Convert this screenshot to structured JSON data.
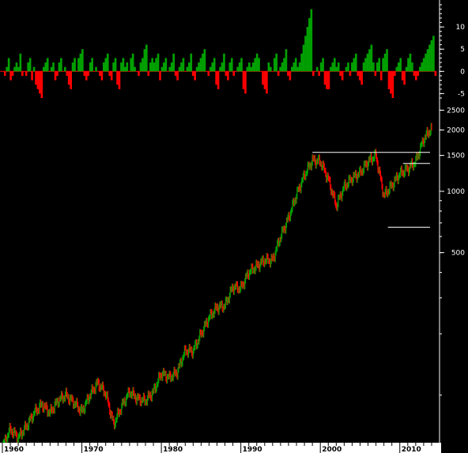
{
  "chart_data": [
    {
      "type": "bar",
      "panel": "momentum",
      "y_scale": "linear",
      "ylim": [
        -6,
        15
      ],
      "y_ticks": [
        10,
        5,
        0,
        -5
      ],
      "positive_color": "#00a000",
      "negative_color": "#ff0000",
      "x_range": [
        1959.7,
        2014.6
      ],
      "x": [
        1960.0,
        1960.5,
        1961.0,
        1961.5,
        1962.0,
        1962.5,
        1963.0,
        1963.5,
        1964.0,
        1964.5,
        1965.0,
        1965.5,
        1966.0,
        1966.5,
        1967.0,
        1967.5,
        1968.0,
        1968.5,
        1969.0,
        1969.5,
        1970.0,
        1970.5,
        1971.0,
        1971.5,
        1972.0,
        1972.5,
        1973.0,
        1973.5,
        1974.0,
        1974.5,
        1975.0,
        1975.5,
        1976.0,
        1976.5,
        1977.0,
        1977.5,
        1978.0,
        1978.5,
        1979.0,
        1979.5,
        1980.0,
        1980.5,
        1981.0,
        1981.5,
        1982.0,
        1982.5,
        1983.0,
        1983.5,
        1984.0,
        1984.5,
        1985.0,
        1985.5,
        1986.0,
        1986.5,
        1987.0,
        1987.5,
        1988.0,
        1988.5,
        1989.0,
        1989.5,
        1990.0,
        1990.5,
        1991.0,
        1991.5,
        1992.0,
        1992.5,
        1993.0,
        1993.5,
        1994.0,
        1994.5,
        1995.0,
        1995.5,
        1996.0,
        1996.5,
        1997.0,
        1997.5,
        1998.0,
        1998.5,
        1999.0,
        1999.5,
        2000.0,
        2000.5,
        2001.0,
        2001.5,
        2002.0,
        2002.5,
        2003.0,
        2003.5,
        2004.0,
        2004.5,
        2005.0,
        2005.5,
        2006.0,
        2006.5,
        2007.0,
        2007.5,
        2008.0,
        2008.5,
        2009.0,
        2009.5,
        2010.0,
        2010.5,
        2011.0,
        2011.5,
        2012.0,
        2012.5,
        2013.0,
        2013.5,
        2014.0,
        2014.5
      ],
      "values": [
        0,
        0,
        -1,
        1,
        3,
        -2,
        -1,
        1,
        2,
        1,
        4,
        -1,
        0,
        -1,
        2,
        3,
        -2,
        1,
        -3,
        -4,
        -5,
        -6,
        1,
        2,
        3,
        0,
        1,
        2,
        -2,
        -1,
        2,
        3,
        0,
        1,
        -1,
        -3,
        -4,
        2,
        3,
        0,
        3,
        4,
        5,
        -1,
        -2,
        -1,
        2,
        3,
        0,
        1,
        0,
        -1,
        -2,
        2,
        3,
        4,
        -1,
        -2,
        2,
        3,
        -3,
        -4,
        2,
        3,
        1,
        2,
        0,
        3,
        4,
        1,
        0,
        -1,
        2,
        3,
        5,
        6,
        -1,
        2,
        3,
        2,
        3,
        4,
        -2,
        1,
        2,
        3,
        0,
        1,
        2,
        4,
        -1,
        -2,
        1,
        2,
        3,
        0,
        1,
        2,
        4,
        -1,
        -2,
        1,
        2,
        3,
        4,
        5,
        0,
        -1,
        1,
        2,
        3,
        -3,
        -4,
        1,
        2,
        4,
        -1,
        -2,
        2,
        3,
        -1,
        0,
        1,
        2,
        3,
        -4,
        -5,
        1,
        2,
        1,
        2,
        3,
        4,
        3,
        0,
        -3,
        -4,
        -5,
        2,
        1,
        0,
        3,
        4,
        -1,
        1,
        2,
        3,
        5,
        -1,
        -2,
        1,
        2,
        3,
        1,
        2,
        4,
        6,
        8,
        10,
        12,
        14,
        -1,
        0,
        1,
        -1,
        2,
        3,
        -3,
        -4,
        -4,
        1,
        2,
        3,
        1,
        2,
        -1,
        -2,
        0,
        1,
        2,
        -1,
        2,
        3,
        4,
        -1,
        -2,
        -3,
        2,
        3,
        4,
        5,
        6,
        2,
        -1,
        2,
        3,
        -2,
        3,
        4,
        5,
        -4,
        -5,
        -6,
        -1,
        1,
        2,
        3,
        -2,
        -3,
        1,
        3,
        4,
        2,
        -1,
        -2,
        -1,
        1,
        2,
        3,
        4,
        5,
        6,
        7,
        8,
        -1
      ]
    },
    {
      "type": "candlestick",
      "panel": "price",
      "y_scale": "log",
      "ylim": [
        60,
        2600
      ],
      "y_ticks": [
        2500,
        2000,
        1500,
        1000,
        500
      ],
      "x_ticks": [
        "1960",
        "1970",
        "1980",
        "1990",
        "2000",
        "2010"
      ],
      "x_range": [
        1959.7,
        2014.6
      ],
      "up_color": "#00a000",
      "down_color": "#ff0000",
      "points": [
        [
          1960,
          56
        ],
        [
          1961,
          68
        ],
        [
          1962,
          62
        ],
        [
          1963,
          70
        ],
        [
          1964,
          82
        ],
        [
          1965,
          90
        ],
        [
          1966,
          82
        ],
        [
          1967,
          94
        ],
        [
          1968,
          100
        ],
        [
          1969,
          92
        ],
        [
          1970,
          83
        ],
        [
          1971,
          100
        ],
        [
          1972,
          115
        ],
        [
          1973,
          102
        ],
        [
          1974,
          72
        ],
        [
          1975,
          88
        ],
        [
          1976,
          104
        ],
        [
          1977,
          96
        ],
        [
          1978,
          94
        ],
        [
          1979,
          104
        ],
        [
          1980,
          128
        ],
        [
          1981,
          122
        ],
        [
          1982,
          130
        ],
        [
          1983,
          165
        ],
        [
          1984,
          165
        ],
        [
          1985,
          200
        ],
        [
          1986,
          240
        ],
        [
          1987,
          270
        ],
        [
          1988,
          275
        ],
        [
          1989,
          340
        ],
        [
          1990,
          335
        ],
        [
          1991,
          400
        ],
        [
          1992,
          430
        ],
        [
          1993,
          460
        ],
        [
          1994,
          460
        ],
        [
          1995,
          600
        ],
        [
          1996,
          740
        ],
        [
          1997,
          960
        ],
        [
          1998,
          1200
        ],
        [
          1999,
          1420
        ],
        [
          2000,
          1400
        ],
        [
          2001,
          1150
        ],
        [
          2002,
          850
        ],
        [
          2003,
          1050
        ],
        [
          2004,
          1160
        ],
        [
          2005,
          1230
        ],
        [
          2006,
          1400
        ],
        [
          2007,
          1500
        ],
        [
          2008,
          950
        ],
        [
          2009,
          1070
        ],
        [
          2010,
          1220
        ],
        [
          2011,
          1290
        ],
        [
          2012,
          1400
        ],
        [
          2013,
          1800
        ],
        [
          2014,
          2050
        ]
      ],
      "horizontal_lines": [
        {
          "value": 1552,
          "x_from": 1999.0,
          "x_to": 2013.8
        },
        {
          "value": 1370,
          "x_from": 2010.4,
          "x_to": 2013.8
        },
        {
          "value": 667,
          "x_from": 2008.5,
          "x_to": 2013.8
        }
      ]
    }
  ]
}
